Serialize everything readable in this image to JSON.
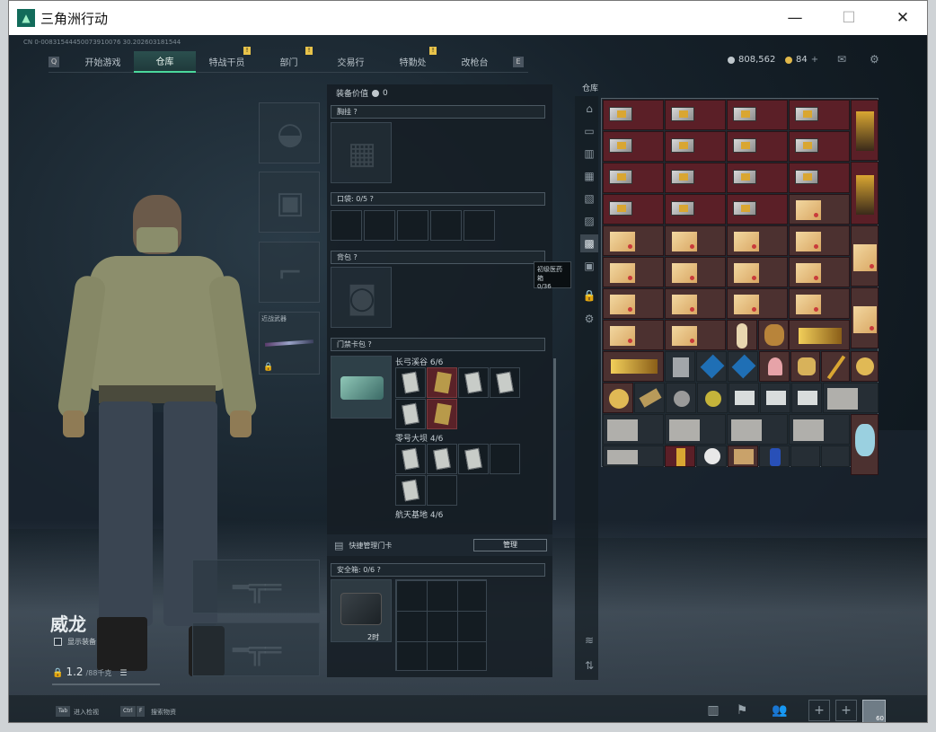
{
  "window": {
    "title": "三角洲行动"
  },
  "header": {
    "uid": "CN 0-00831544450073910076 30.202603181544"
  },
  "nav": {
    "left_key": "Q",
    "right_key": "E",
    "tabs": [
      {
        "label": "开始游戏",
        "badge": ""
      },
      {
        "label": "仓库",
        "badge": "",
        "active": true
      },
      {
        "label": "特战干员",
        "badge": "!"
      },
      {
        "label": "部门",
        "badge": "!"
      },
      {
        "label": "交易行",
        "badge": ""
      },
      {
        "label": "特勤处",
        "badge": "!"
      },
      {
        "label": "改枪台",
        "badge": ""
      }
    ]
  },
  "currency": {
    "silver": "808,562",
    "gold": "84",
    "gold_plus": "+"
  },
  "character": {
    "name": "威龙",
    "show_gear": "显示装备",
    "weight": "1.2",
    "weight_max": "/88千克"
  },
  "gear": {
    "melee_label": "近战武器"
  },
  "middle": {
    "equip_value_label": "装备价值",
    "equip_value": "0",
    "chest_label": "胸挂",
    "pocket_label": "口袋",
    "pocket_value": "0/5",
    "backpack_label": "背包",
    "tooltip_title": "初级医药箱",
    "tooltip_value": "0/36",
    "keycard_label": "门禁卡包",
    "map1_label": "长弓溪谷",
    "map1_count": "6/6",
    "map2_label": "零号大坝",
    "map2_count": "4/6",
    "map3_label": "航天基地",
    "map3_count": "4/6",
    "quick_manage": "快捷管理门卡",
    "manage_btn": "管理",
    "safe_label": "安全箱",
    "safe_value": "0/6",
    "safe_time": "2时"
  },
  "warehouse": {
    "title": "仓库"
  },
  "bottom": {
    "key1": "Tab",
    "key1_label": "进入检视",
    "key2": "Ctrl",
    "key2b": "F",
    "key2_label": "搜索物资",
    "level": "60"
  }
}
